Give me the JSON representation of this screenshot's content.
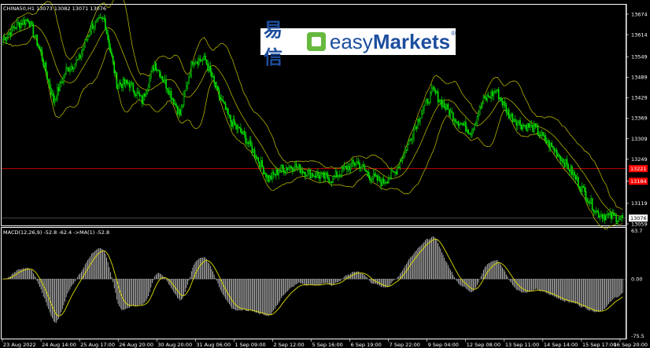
{
  "window": {
    "symbol_header": "CHINA50,H1  13073 13082 13071 13076",
    "macd_header": "MACD(12,26,9) -52.8 -62.4  ->MA(1) -52.8"
  },
  "logo": {
    "cn": "易信",
    "en_light": "easy",
    "en_bold": "Markets",
    "reg": "®"
  },
  "chart_data": {
    "type": "candlestick",
    "price_axis": {
      "range": [
        13059,
        13697
      ],
      "ticks": [
        "13674",
        "13614",
        "13549",
        "13489",
        "13429",
        "13369",
        "13309",
        "13249",
        "13184",
        "13119",
        "13059"
      ],
      "markers": [
        {
          "label": "13221",
          "value": 13221,
          "color": "#ff0000"
        },
        {
          "label": "13184",
          "value": 13184,
          "color": "#ff0000"
        },
        {
          "label": "13076",
          "value": 13076,
          "color": "#ffffff"
        }
      ]
    },
    "macd_axis": {
      "range": [
        -75.5,
        63.7
      ],
      "ticks": [
        "63.7",
        "0.00",
        "-75.5"
      ]
    },
    "time_labels": [
      "23 Aug 2022",
      "24 Aug 14:00",
      "25 Aug 17:00",
      "26 Aug 20:00",
      "30 Aug 20:00",
      "31 Aug 06:00",
      "1 Sep 09:00",
      "2 Sep 12:00",
      "5 Sep 16:00",
      "6 Sep 19:00",
      "7 Sep 22:00",
      "9 Sep 04:00",
      "12 Sep 08:00",
      "13 Sep 11:00",
      "14 Sep 14:00",
      "15 Sep 17:00",
      "16 Sep 20:00"
    ],
    "anchors": [
      [
        0,
        13600
      ],
      [
        10,
        13640
      ],
      [
        20,
        13660
      ],
      [
        30,
        13560
      ],
      [
        40,
        13420
      ],
      [
        50,
        13510
      ],
      [
        60,
        13540
      ],
      [
        70,
        13640
      ],
      [
        80,
        13660
      ],
      [
        90,
        13470
      ],
      [
        100,
        13470
      ],
      [
        110,
        13420
      ],
      [
        120,
        13530
      ],
      [
        130,
        13460
      ],
      [
        140,
        13380
      ],
      [
        150,
        13540
      ],
      [
        160,
        13540
      ],
      [
        170,
        13440
      ],
      [
        180,
        13360
      ],
      [
        190,
        13320
      ],
      [
        200,
        13260
      ],
      [
        210,
        13190
      ],
      [
        220,
        13220
      ],
      [
        230,
        13230
      ],
      [
        240,
        13210
      ],
      [
        250,
        13200
      ],
      [
        260,
        13190
      ],
      [
        270,
        13220
      ],
      [
        280,
        13240
      ],
      [
        290,
        13200
      ],
      [
        300,
        13180
      ],
      [
        310,
        13210
      ],
      [
        320,
        13290
      ],
      [
        330,
        13380
      ],
      [
        340,
        13450
      ],
      [
        350,
        13400
      ],
      [
        360,
        13360
      ],
      [
        370,
        13330
      ],
      [
        380,
        13420
      ],
      [
        390,
        13450
      ],
      [
        400,
        13380
      ],
      [
        410,
        13350
      ],
      [
        420,
        13340
      ],
      [
        430,
        13300
      ],
      [
        440,
        13260
      ],
      [
        450,
        13210
      ],
      [
        460,
        13150
      ],
      [
        470,
        13090
      ],
      [
        480,
        13080
      ],
      [
        490,
        13076
      ]
    ],
    "bollinger_width_points": 90,
    "macd_scale_points_per_unit": 1
  }
}
